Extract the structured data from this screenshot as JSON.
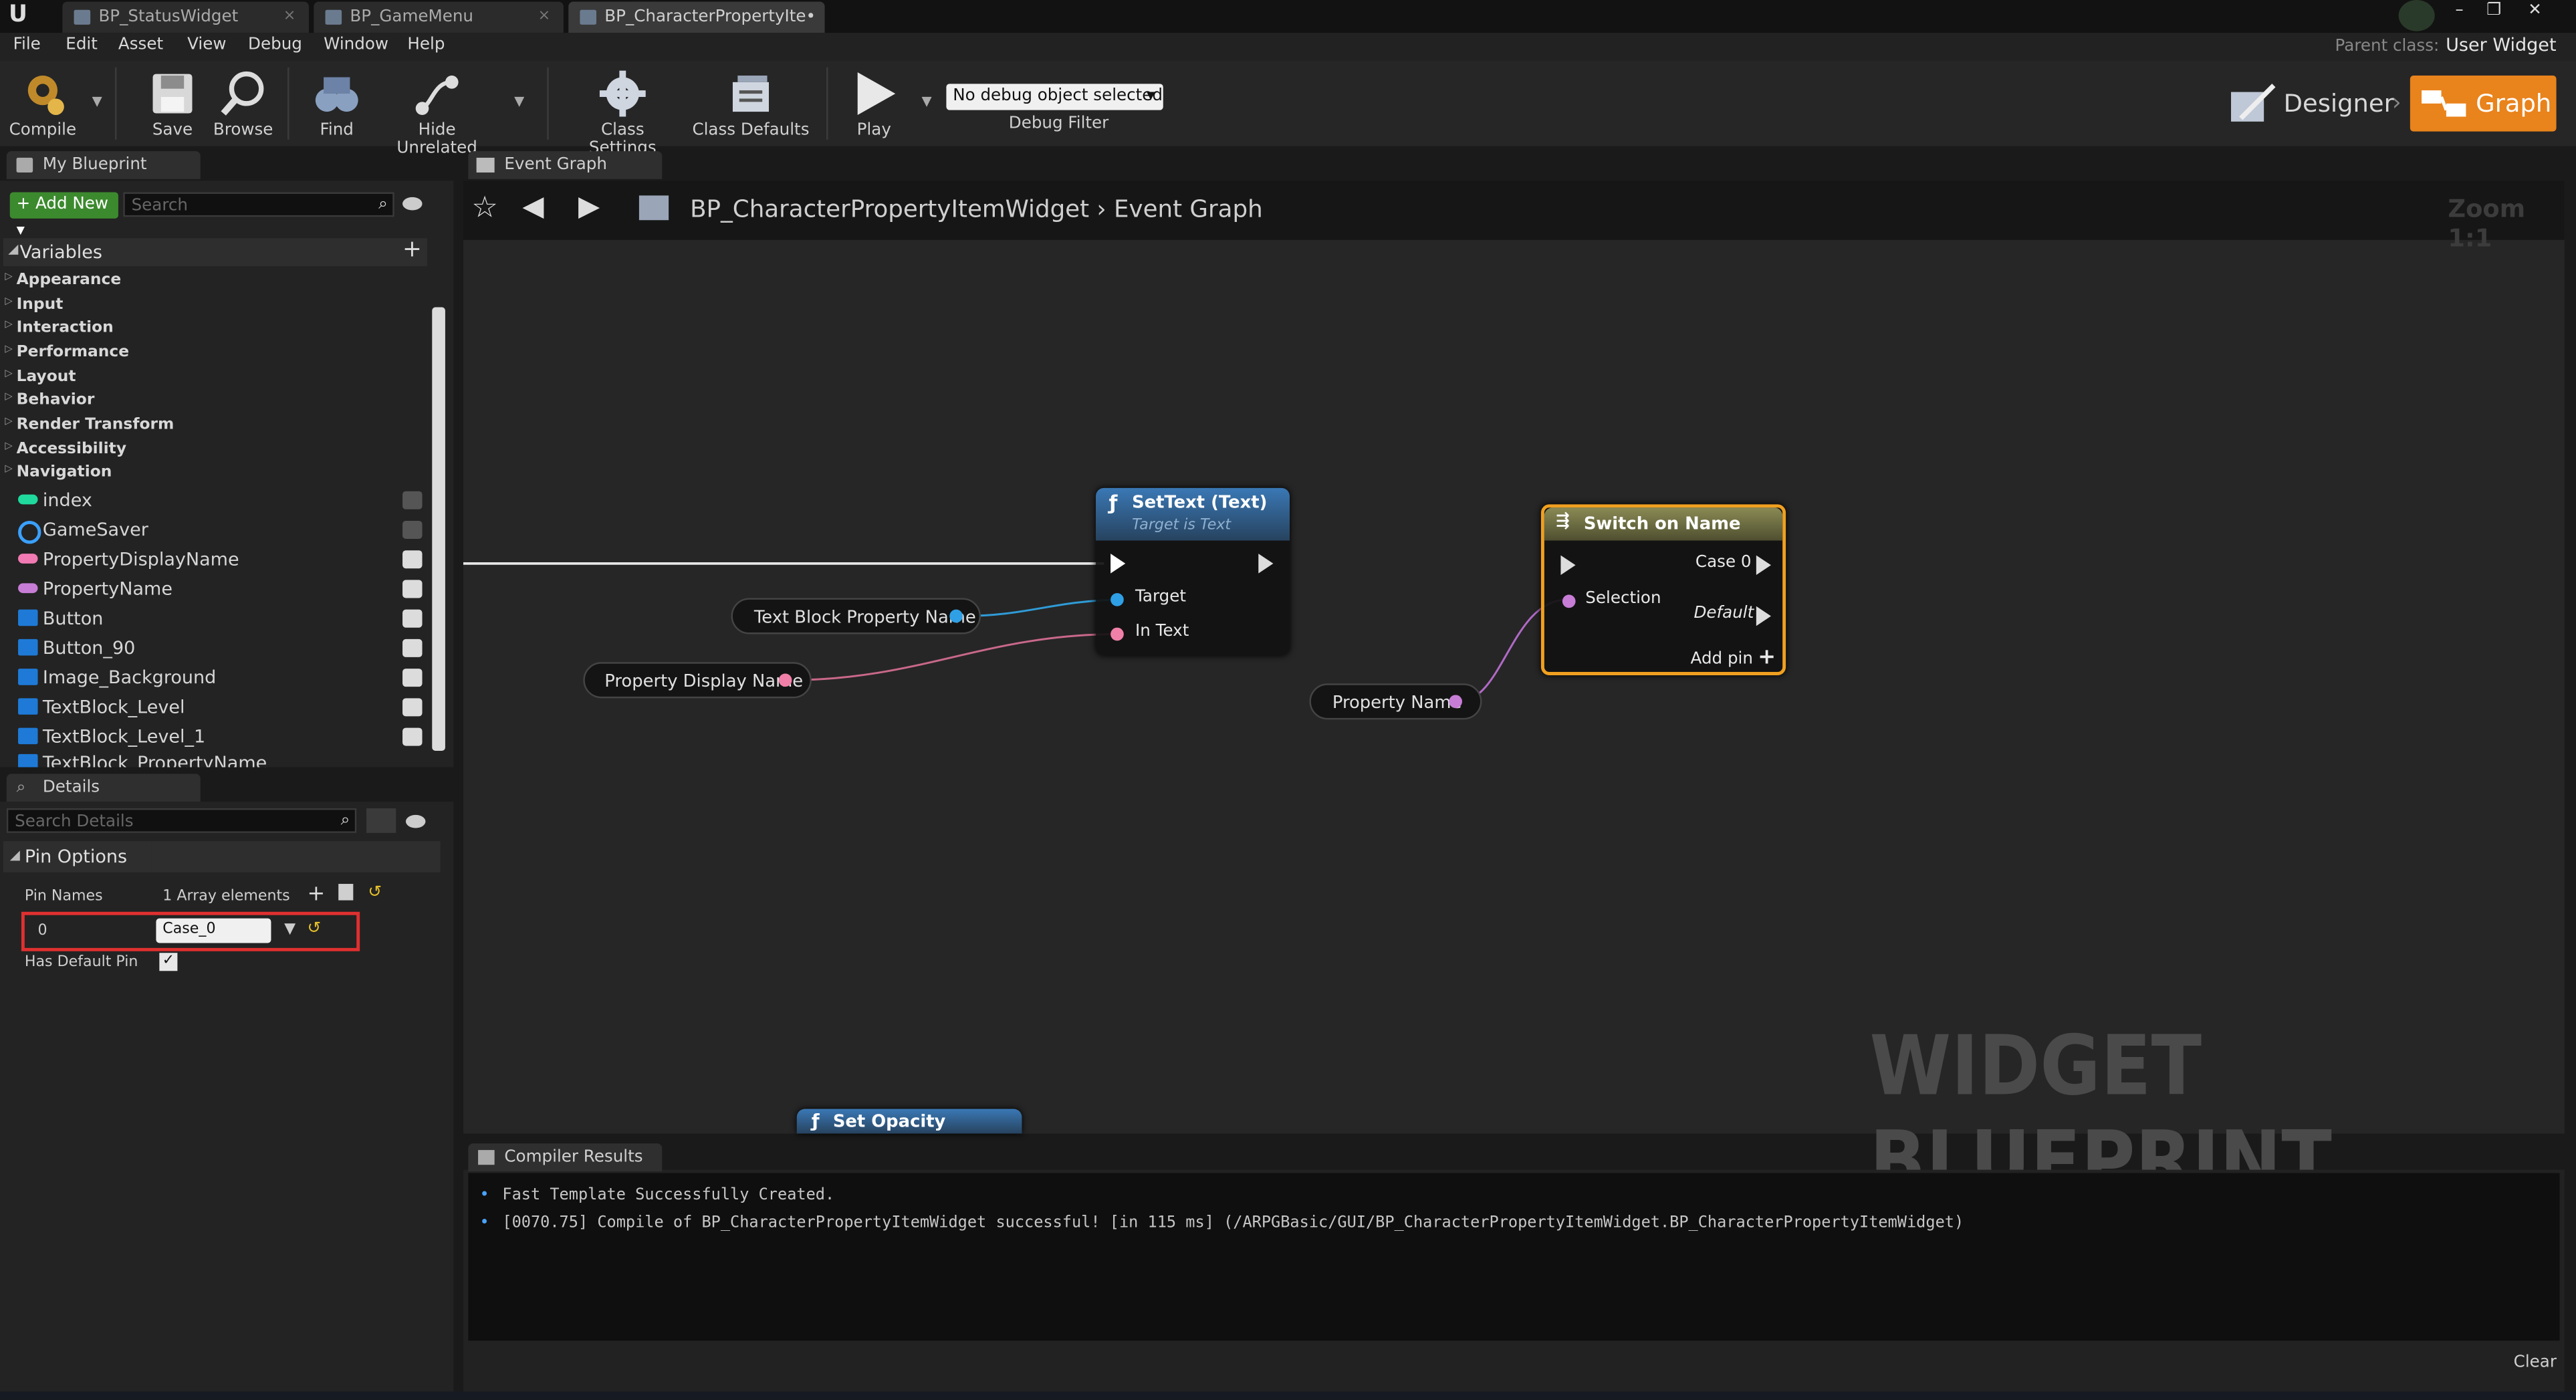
{
  "window": {
    "tabs": [
      "BP_StatusWidget",
      "BP_GameMenu",
      "BP_CharacterPropertyIte•"
    ],
    "parent_class_label": "Parent class:",
    "parent_class_value": "User Widget"
  },
  "menu": [
    "File",
    "Edit",
    "Asset",
    "View",
    "Debug",
    "Window",
    "Help"
  ],
  "toolbar": {
    "compile": "Compile",
    "save": "Save",
    "browse": "Browse",
    "find": "Find",
    "hide_unrelated": "Hide Unrelated",
    "class_settings": "Class Settings",
    "class_defaults": "Class Defaults",
    "play": "Play",
    "debug_select": "No debug object selected",
    "debug_filter": "Debug Filter",
    "designer": "Designer",
    "graph": "Graph"
  },
  "my_blueprint": {
    "tab": "My Blueprint",
    "add_new": "Add New",
    "search_placeholder": "Search",
    "variables_header": "Variables",
    "categories": [
      "Appearance",
      "Input",
      "Interaction",
      "Performance",
      "Layout",
      "Behavior",
      "Render Transform",
      "Accessibility",
      "Navigation"
    ],
    "variables": [
      {
        "name": "index",
        "color": "#1fd99d"
      },
      {
        "name": "GameSaver",
        "color": "#3aa0ff"
      },
      {
        "name": "PropertyDisplayName",
        "color": "#f27ab3"
      },
      {
        "name": "PropertyName",
        "color": "#c77dd6"
      },
      {
        "name": "Button",
        "color": "#1e7ad6"
      },
      {
        "name": "Button_90",
        "color": "#1e7ad6"
      },
      {
        "name": "Image_Background",
        "color": "#1e7ad6"
      },
      {
        "name": "TextBlock_Level",
        "color": "#1e7ad6"
      },
      {
        "name": "TextBlock_Level_1",
        "color": "#1e7ad6"
      },
      {
        "name": "TextBlock_PropertyName",
        "color": "#1e7ad6"
      }
    ]
  },
  "details": {
    "tab": "Details",
    "search_placeholder": "Search Details",
    "section": "Pin Options",
    "pin_names_label": "Pin Names",
    "pin_names_value": "1 Array elements",
    "index": "0",
    "case_value": "Case_0",
    "has_default_pin": "Has Default Pin"
  },
  "graph": {
    "tab": "Event Graph",
    "breadcrumb_root": "BP_CharacterPropertyItemWidget",
    "breadcrumb_leaf": "Event Graph",
    "zoom": "Zoom 1:1",
    "watermark": "WIDGET BLUEPRINT",
    "settext_title": "SetText (Text)",
    "settext_subtitle": "Target is Text",
    "settext_target": "Target",
    "settext_intext": "In Text",
    "switch_title": "Switch on Name",
    "switch_case0": "Case 0",
    "switch_selection": "Selection",
    "switch_default": "Default",
    "switch_addpin": "Add pin",
    "var_textblock": "Text Block Property Name",
    "var_displayname": "Property Display Name",
    "var_propname": "Property Name",
    "set_opacity": "Set Opacity"
  },
  "compiler": {
    "tab": "Compiler Results",
    "lines": [
      "Fast Template Successfully Created.",
      "[0070.75] Compile of BP_CharacterPropertyItemWidget successful! [in 115 ms] (/ARPGBasic/GUI/BP_CharacterPropertyItemWidget.BP_CharacterPropertyItemWidget)"
    ],
    "clear": "Clear"
  }
}
